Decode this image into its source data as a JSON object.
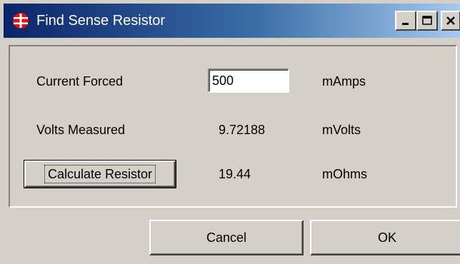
{
  "window": {
    "title": "Find Sense Resistor",
    "icon": "app-red-circle-icon",
    "controls": [
      "minimize-icon",
      "maximize-icon",
      "close-icon"
    ],
    "colors": {
      "titlebar_start": "#0a246a",
      "titlebar_end": "#a6caf0",
      "face": "#d4d0c8"
    }
  },
  "form": {
    "current": {
      "label": "Current Forced",
      "value": "500",
      "unit": "mAmps"
    },
    "volts": {
      "label": "Volts Measured",
      "value": "9.72188",
      "unit": "mVolts"
    },
    "resistor": {
      "button_label": "Calculate Resistor",
      "value": "19.44",
      "unit": "mOhms"
    }
  },
  "buttons": {
    "cancel": "Cancel",
    "ok": "OK"
  }
}
